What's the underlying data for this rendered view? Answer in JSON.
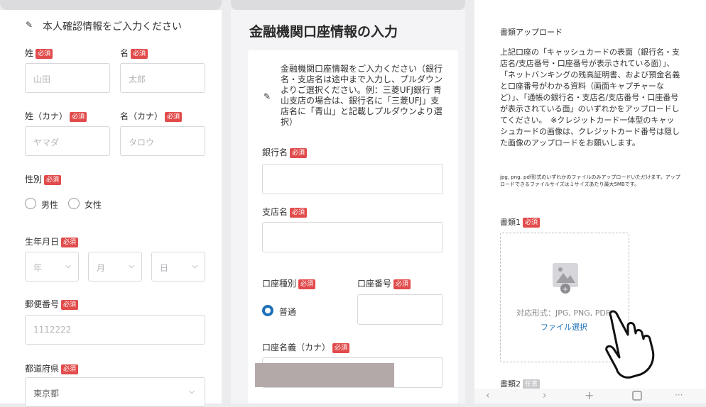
{
  "left": {
    "header": "本人確認情報をご入力ください",
    "required": "必須",
    "last_name_label": "姓",
    "last_name_ph": "山田",
    "first_name_label": "名",
    "first_name_ph": "太郎",
    "last_kana_label": "姓（カナ）",
    "last_kana_ph": "ヤマダ",
    "first_kana_label": "名（カナ）",
    "first_kana_ph": "タロウ",
    "gender_label": "性別",
    "male": "男性",
    "female": "女性",
    "dob_label": "生年月日",
    "year": "年",
    "month": "月",
    "day": "日",
    "postal_label": "郵便番号",
    "postal_ph": "1112222",
    "pref_label": "都道府県",
    "pref_value": "東京都"
  },
  "middle": {
    "title": "金融機関口座情報の入力",
    "notice": "金融機関口座情報をご入力ください（銀行名・支店名は途中まで入力し、プルダウンよりご選択ください。例：三菱UFJ銀行 青山支店の場合は、銀行名に「三菱UFJ」支店名に「青山」と記載しプルダウンより選択）",
    "bank_label": "銀行名",
    "branch_label": "支店名",
    "type_label": "口座種別",
    "type_value": "普通",
    "number_label": "口座番号",
    "holder_label": "口座名義（カナ）",
    "required": "必須"
  },
  "right": {
    "section_title": "書類アップロード",
    "description": "上記口座の「キャッシュカードの表面（銀行名・支店名/支店番号・口座番号が表示されている面）」、「ネットバンキングの残高証明書、および預金名義と口座番号がわかる資料（画面キャプチャーなど）」、「通帳の銀行名・支店名/支店番号・口座番号が表示されている面」のいずれかをアップロードしてください。　※クレジットカード一体型のキャッシュカードの画像は、クレジットカード番号は隠した画像のアップロードをお願いします。",
    "small_note": "jpg, png, pdf形式のいずれかのファイルのみアップロードいただけます。アップロードできるファイルサイズは１サイズあたり最大5MBです。",
    "doc1_label": "書類1",
    "required": "必須",
    "formats": "対応形式：JPG, PNG, PDF",
    "select_file": "ファイル選択",
    "doc2_label": "書類2",
    "optional": "任意"
  },
  "colors": {
    "required": "#e24b4b",
    "accent": "#1f70b8"
  }
}
